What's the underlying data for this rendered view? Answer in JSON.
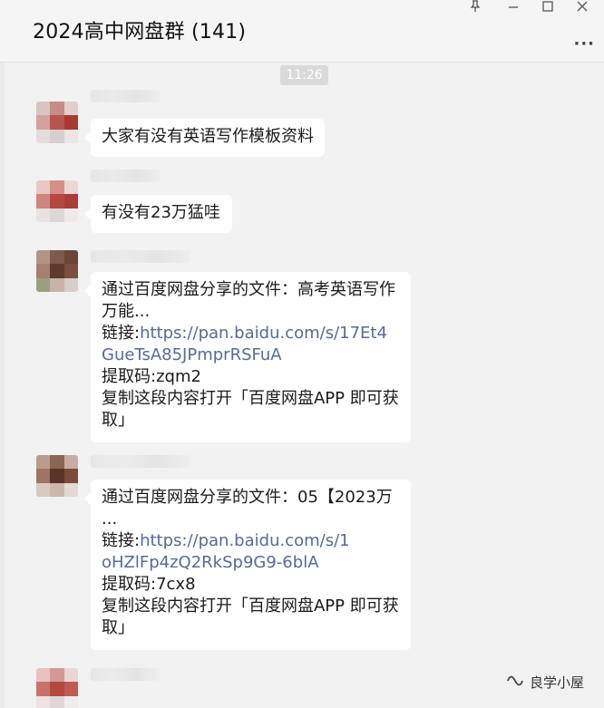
{
  "window": {
    "title": "2024高中网盘群 (141)",
    "pin_icon": "pin-icon",
    "minimize_icon": "minimize-icon",
    "maximize_icon": "maximize-icon",
    "close_icon": "close-icon",
    "more_icon": "more-icon"
  },
  "chat": {
    "time_separator": "11:26",
    "messages": [
      {
        "text": "大家有没有英语写作模板资料"
      },
      {
        "text": "有没有23万猛哇"
      },
      {
        "line1": "通过百度网盘分享的文件：高考英语写作",
        "line2": "万能...",
        "link_label": "链接:",
        "link_part1": "https://pan.baidu.com/s/17Et4",
        "link_part2": "GueTsA85JPmprRSFuA",
        "code": "提取码:zqm2",
        "copy1": "复制这段内容打开「百度网盘APP 即可获",
        "copy2": "取」"
      },
      {
        "line1": "通过百度网盘分享的文件：05【2023万",
        "line2": "...",
        "link_label": "链接:",
        "link_part1": "https://pan.baidu.com/s/1",
        "link_part2": "oHZlFp4zQ2RkSp9G9-6blA",
        "code": "提取码:7cx8",
        "copy1": "复制这段内容打开「百度网盘APP 即可获",
        "copy2": "取」"
      }
    ]
  },
  "watermark": {
    "text": "良学小屋",
    "icon": "wechat-channel-icon"
  },
  "colors": {
    "link": "#576b95",
    "bubble": "#ffffff",
    "background": "#f2f2f2"
  }
}
